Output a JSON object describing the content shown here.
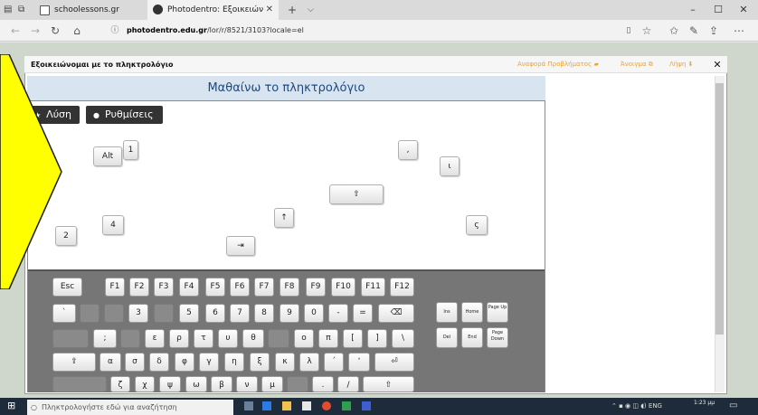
{
  "browser": {
    "tabs": [
      {
        "label": "schoolessons.gr",
        "active": false
      },
      {
        "label": "Photodentro: Εξοικειών",
        "active": true
      }
    ],
    "url_host": "photodentro.edu.gr",
    "url_path": "/lor/r/8521/3103?locale=el",
    "window_controls": {
      "minimize": "–",
      "maximize": "☐",
      "close": "✕"
    }
  },
  "modal": {
    "title": "Εξοικειώνομαι με το πληκτρολόγιο",
    "report_link": "Αναφορά Προβλήματος",
    "open_link": "Άνοιγμα",
    "download_link": "Λήψη",
    "close": "✕"
  },
  "activity": {
    "title": "Μαθαίνω το πληκτρολόγιο",
    "solution_button": "Λύση",
    "settings_button": "Ρυθμίσεις",
    "floating_keys": [
      "Alt",
      "1",
      ",",
      "ι",
      "⇧",
      "↑",
      "4",
      "ς",
      "2",
      "⇥"
    ]
  },
  "keyboard": {
    "row_fn": [
      "Esc",
      "F1",
      "F2",
      "F3",
      "F4",
      "F5",
      "F6",
      "F7",
      "F8",
      "F9",
      "F10",
      "F11",
      "F12"
    ],
    "row_num": [
      "`",
      "",
      "",
      "3",
      "",
      "5",
      "6",
      "7",
      "8",
      "9",
      "0",
      "-",
      "=",
      "⌫"
    ],
    "row_q": [
      "",
      ";",
      "",
      "ε",
      "ρ",
      "τ",
      "υ",
      "θ",
      "",
      "ο",
      "π",
      "[",
      "]",
      "\\"
    ],
    "row_a": [
      "⇪",
      "α",
      "σ",
      "δ",
      "φ",
      "γ",
      "η",
      "ξ",
      "κ",
      "λ",
      "΄",
      "'",
      "⏎"
    ],
    "row_z": [
      "",
      "ζ",
      "χ",
      "ψ",
      "ω",
      "β",
      "ν",
      "μ",
      "",
      ".",
      "/",
      "⇧"
    ],
    "nav_keys": [
      {
        "label": "Ins"
      },
      {
        "label": "Home"
      },
      {
        "label": "Page Up"
      },
      {
        "label": "Del"
      },
      {
        "label": "End"
      },
      {
        "label": "Page Down"
      }
    ]
  },
  "taskbar": {
    "search_placeholder": "Πληκτρολογήστε εδώ για αναζήτηση",
    "language": "ENG",
    "time": "1:23 μμ"
  },
  "colors": {
    "title_bar_blue": "#d9e4f1",
    "link_orange": "#e8a33a",
    "keyboard_gray": "#767676",
    "arrow_yellow": "#ffff00"
  }
}
